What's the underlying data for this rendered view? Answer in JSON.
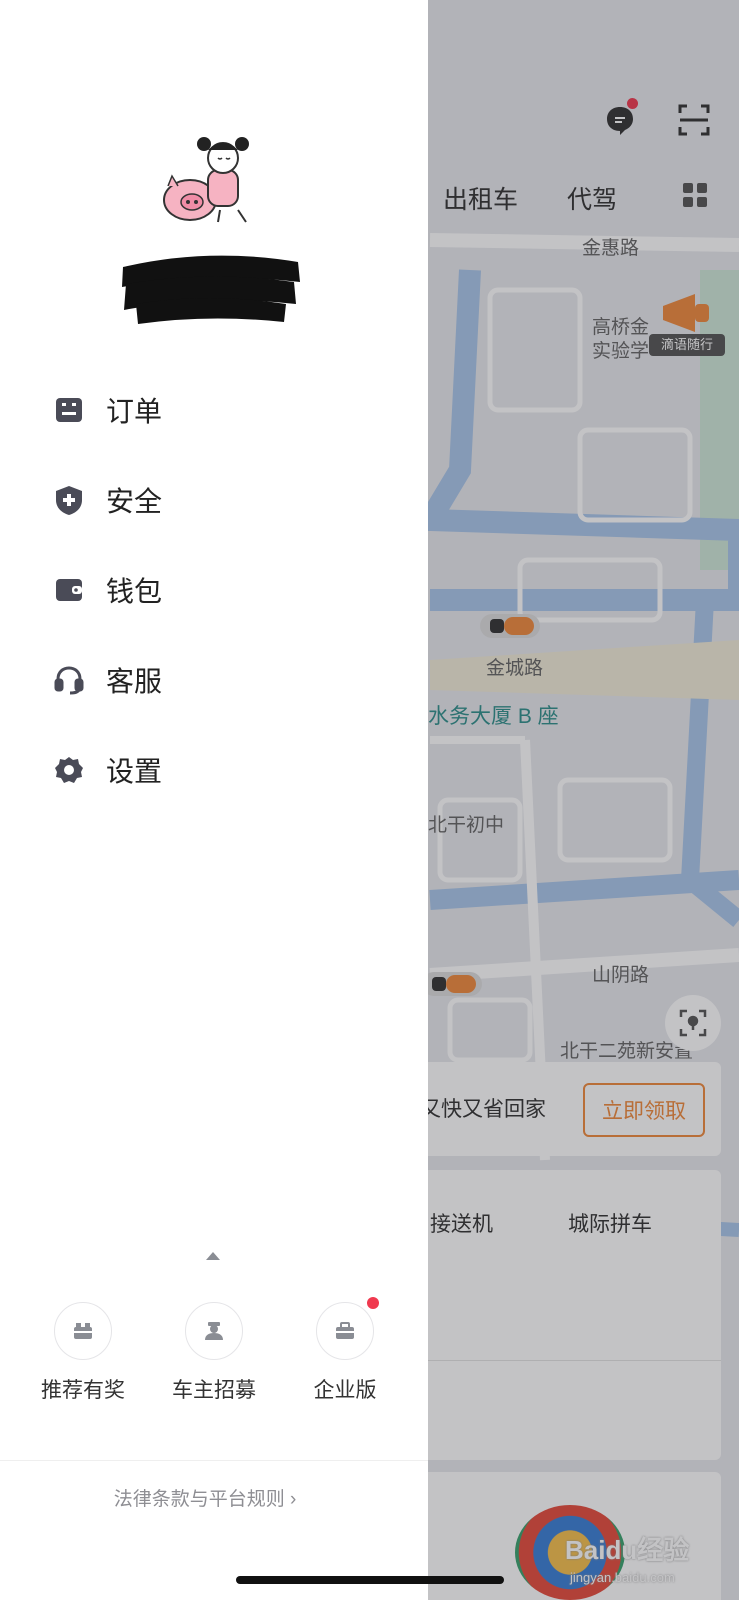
{
  "header": {
    "tabs": [
      "出租车",
      "代驾"
    ],
    "chat_badge_color": "#f0394f"
  },
  "map": {
    "road_labels": [
      "金惠路",
      "金城路",
      "山阴路"
    ],
    "poi_labels": [
      "高桥金",
      "实验学",
      "水务大厦 B 座",
      "北干初中",
      "北干二苑新安置"
    ],
    "ad_badge": "滴语随行"
  },
  "promo": {
    "text": "又快又省回家",
    "button": "立即领取"
  },
  "services": [
    "接送机",
    "城际拼车"
  ],
  "drawer": {
    "menu": [
      {
        "label": "订单",
        "icon": "order-icon"
      },
      {
        "label": "安全",
        "icon": "shield-icon"
      },
      {
        "label": "钱包",
        "icon": "wallet-icon"
      },
      {
        "label": "客服",
        "icon": "headset-icon"
      },
      {
        "label": "设置",
        "icon": "gear-icon"
      }
    ],
    "quick_links": [
      {
        "label": "推荐有奖",
        "icon": "gift-icon",
        "badge": false
      },
      {
        "label": "车主招募",
        "icon": "driver-icon",
        "badge": false
      },
      {
        "label": "企业版",
        "icon": "briefcase-icon",
        "badge": true
      }
    ],
    "legal_link": "法律条款与平台规则 ›"
  },
  "watermark": {
    "text": "Baidu经验",
    "url": "jingyan.baidu.com"
  },
  "colors": {
    "accent_orange": "#f08a3c",
    "badge_red": "#f0394f",
    "icon_dark": "#4a4b57"
  }
}
